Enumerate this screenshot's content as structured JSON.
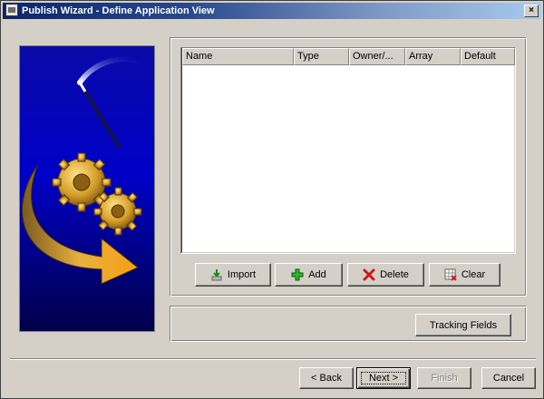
{
  "window": {
    "title": "Publish Wizard - Define Application View",
    "close_glyph": "×"
  },
  "table": {
    "columns": [
      "Name",
      "Type",
      "Owner/...",
      "Array",
      "Default"
    ],
    "rows": []
  },
  "field_buttons": {
    "import": "Import",
    "add": "Add",
    "delete": "Delete",
    "clear": "Clear"
  },
  "tracking": {
    "button": "Tracking Fields"
  },
  "nav": {
    "back": "< Back",
    "next": "Next >",
    "finish": "Finish",
    "cancel": "Cancel"
  },
  "colors": {
    "title_start": "#0a246a",
    "title_end": "#a6caf0",
    "face": "#d4d0c8",
    "banner_blue": "#0000a0"
  }
}
